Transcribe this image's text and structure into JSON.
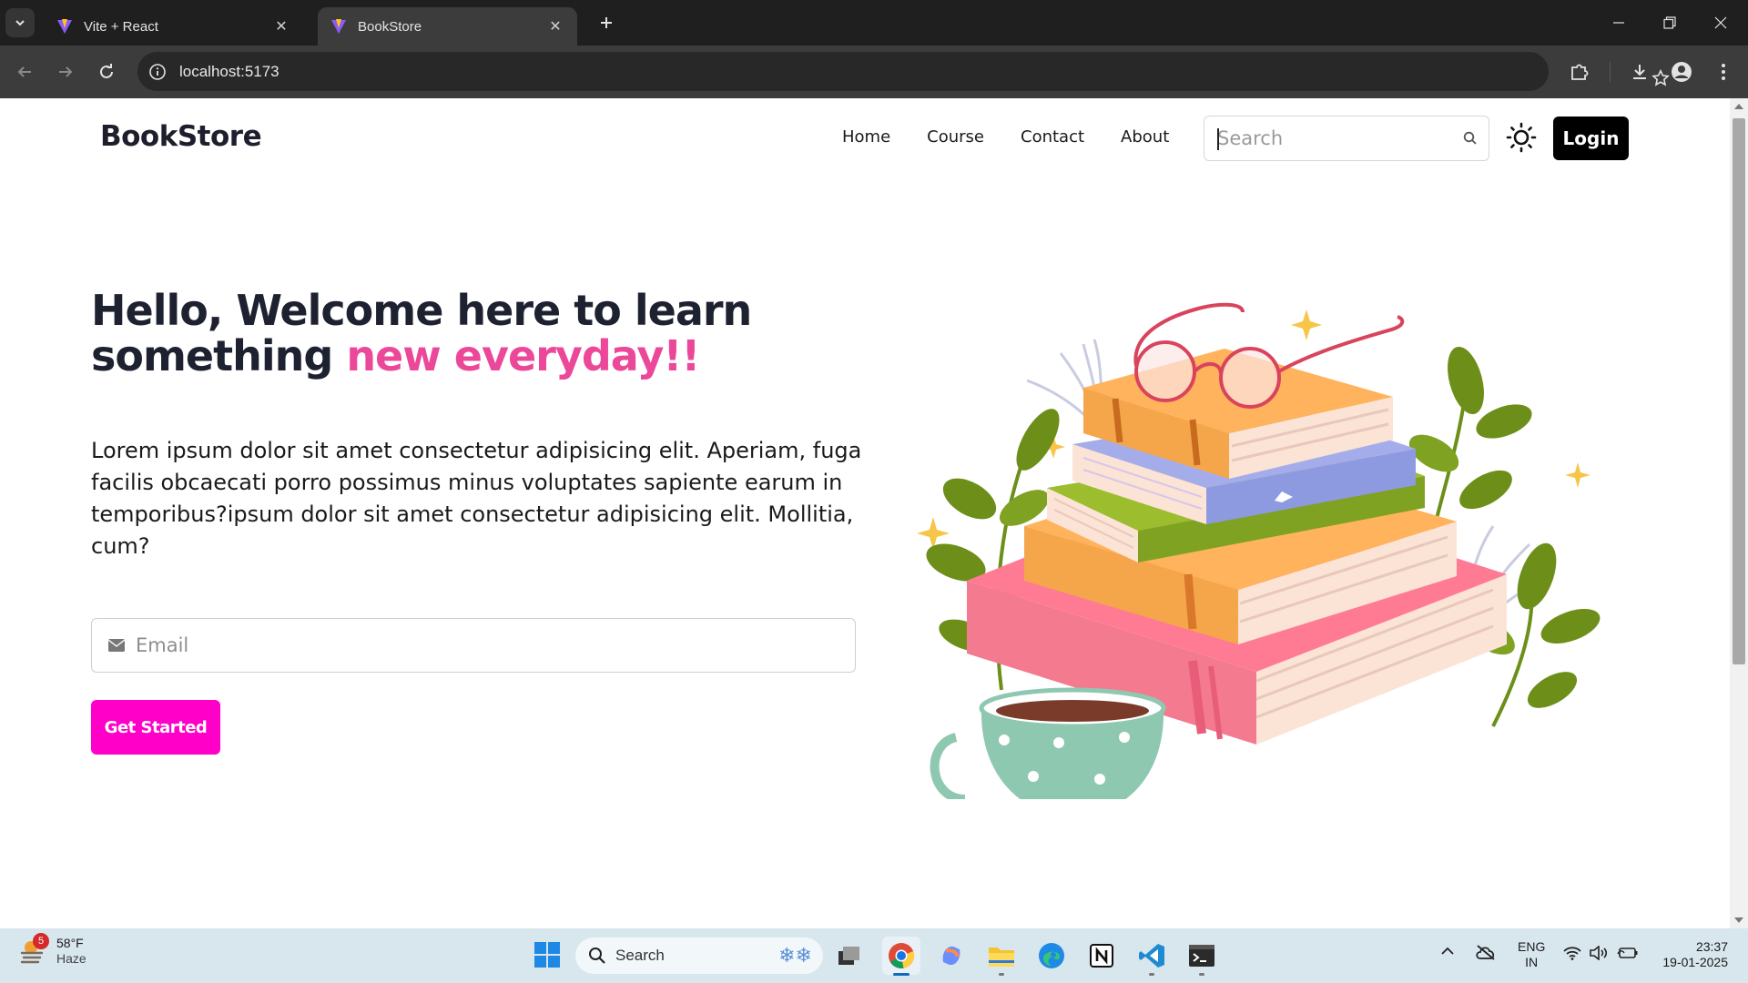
{
  "browser": {
    "tabs": [
      {
        "title": "Vite + React",
        "active": false
      },
      {
        "title": "BookStore",
        "active": true
      }
    ],
    "url": "localhost:5173"
  },
  "site": {
    "brand": "BookStore",
    "nav": [
      "Home",
      "Course",
      "Contact",
      "About"
    ],
    "search_placeholder": "Search",
    "login_label": "Login",
    "hero": {
      "title_line1": "Hello, Welcome here to learn",
      "title_line2_plain": "something ",
      "title_line2_accent": "new everyday!!",
      "description": "Lorem ipsum dolor sit amet consectetur adipisicing elit. Aperiam, fuga facilis obcaecati porro possimus minus voluptates sapiente earum in temporibus?ipsum dolor sit amet consectetur adipisicing elit. Mollitia, cum?",
      "email_placeholder": "Email",
      "cta_label": "Get Started"
    },
    "colors": {
      "accent": "#ec4899",
      "cta": "#ff00c8",
      "login_bg": "#000000"
    }
  },
  "taskbar": {
    "weather": {
      "badge": "5",
      "temp": "58°F",
      "condition": "Haze"
    },
    "search_label": "Search",
    "apps": [
      "task-view",
      "chrome",
      "copilot",
      "file-explorer",
      "edge",
      "notion",
      "vscode",
      "terminal"
    ],
    "language": {
      "line1": "ENG",
      "line2": "IN"
    },
    "time": "23:37",
    "date": "19-01-2025"
  }
}
